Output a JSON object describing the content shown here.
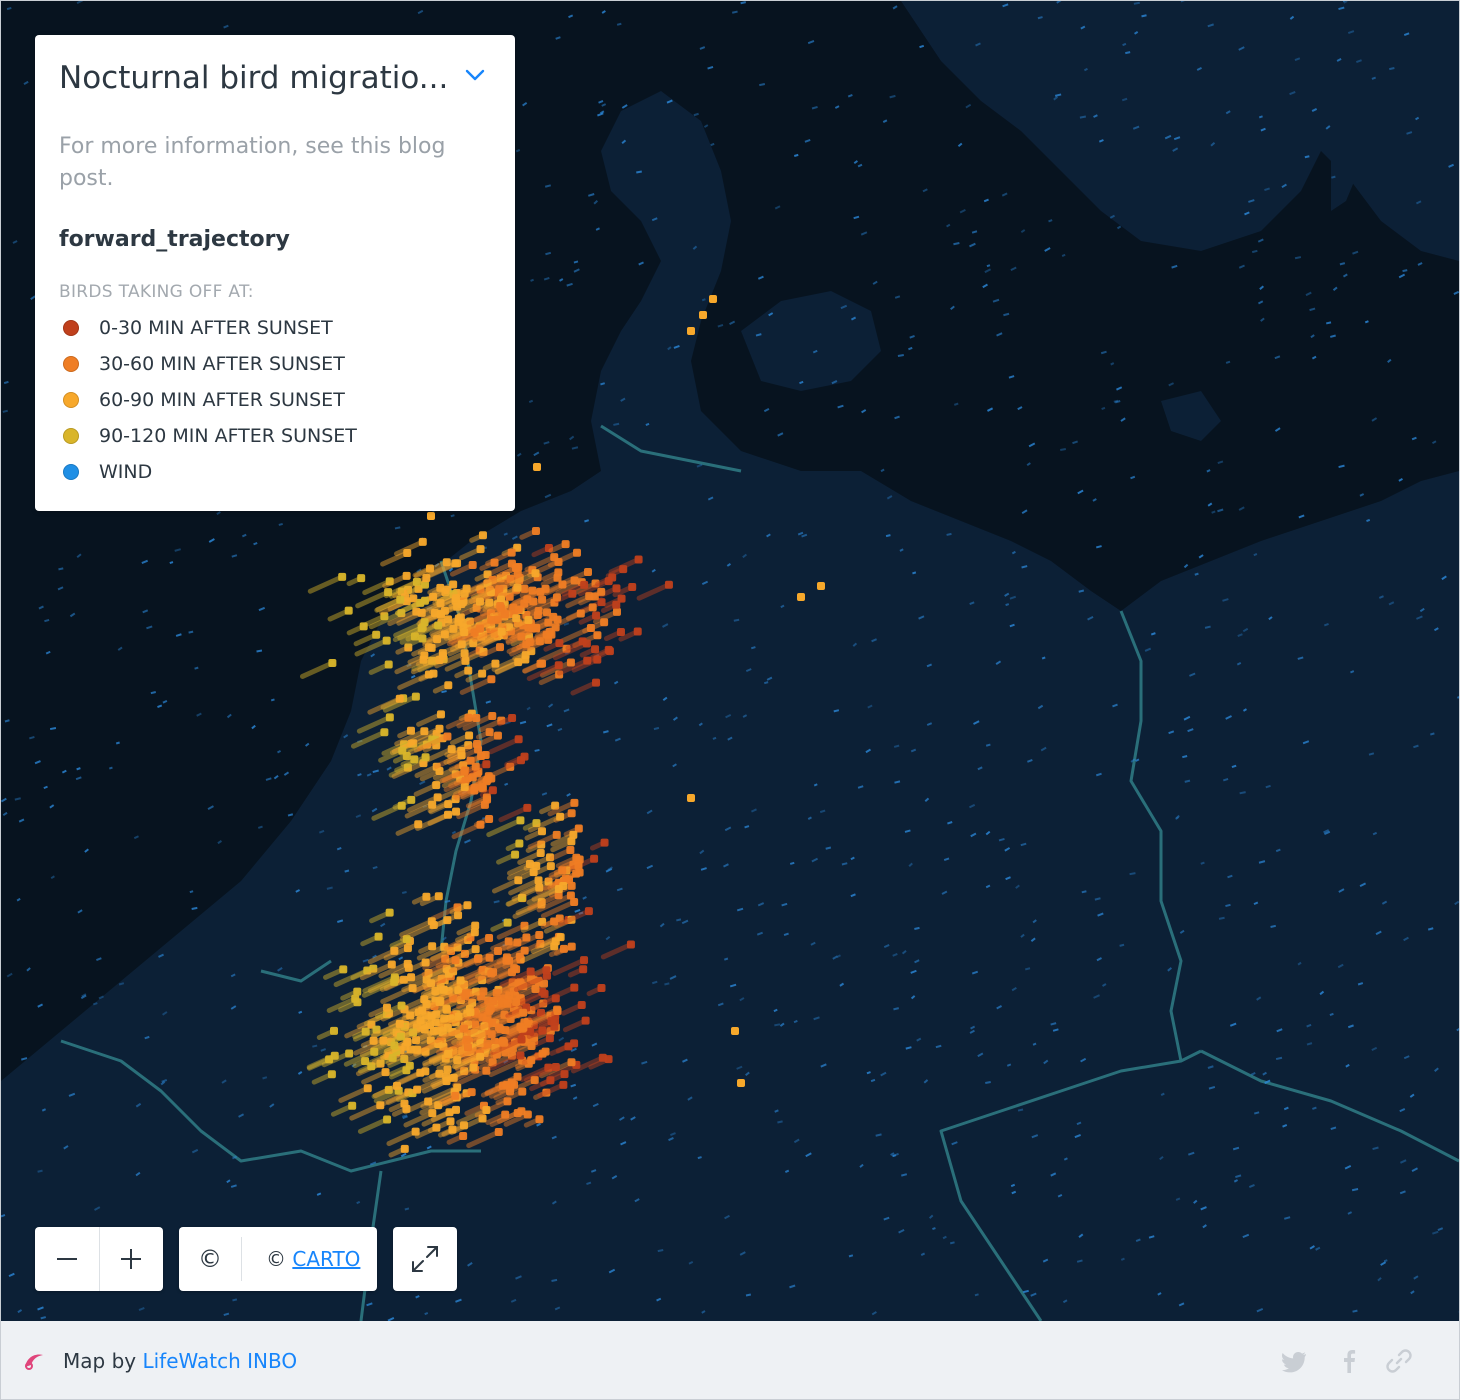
{
  "legend": {
    "title": "Nocturnal bird migratio...",
    "description": "For more information, see this blog post.",
    "layer_name": "forward_trajectory",
    "subtitle": "BIRDS TAKING OFF AT:",
    "items": [
      {
        "label": "0-30 MIN AFTER SUNSET",
        "color": "#c0401c"
      },
      {
        "label": "30-60 MIN AFTER SUNSET",
        "color": "#ef7d24"
      },
      {
        "label": "60-90 MIN AFTER SUNSET",
        "color": "#f7a82b"
      },
      {
        "label": "90-120 MIN AFTER SUNSET",
        "color": "#d9b52a"
      },
      {
        "label": "WIND",
        "color": "#1f8fe5"
      }
    ]
  },
  "controls": {
    "zoom_out_icon": "minus-icon",
    "zoom_in_icon": "plus-icon",
    "attribution_toggle": "©",
    "attribution_prefix": "© ",
    "attribution_link": "CARTO",
    "fullscreen_icon": "expand-icon"
  },
  "footer": {
    "prefix": "Map by ",
    "author": "LifeWatch INBO",
    "share_icons": [
      "twitter-icon",
      "facebook-icon",
      "link-icon"
    ]
  },
  "map_colors": {
    "sea": "#07131f",
    "land": "#0c2036",
    "border": "#2a6f7a",
    "wind": "#2b86d6"
  }
}
